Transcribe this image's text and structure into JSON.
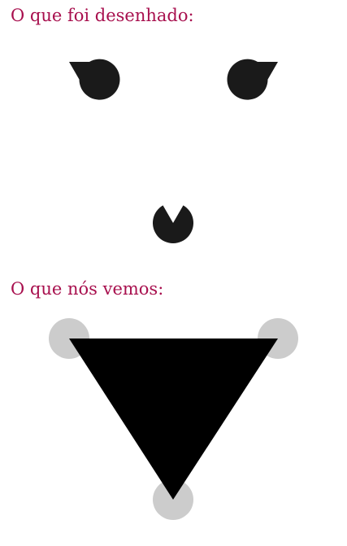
{
  "captions": {
    "drawn": "O que foi desenhado:",
    "seen": "O que nós vemos:"
  },
  "colors": {
    "caption": "#a8104e",
    "inducer": "#1a1a1a",
    "triangle": "#000000",
    "circle_ghost": "#cccccc",
    "background": "#ffffff"
  },
  "figures": {
    "drawn": {
      "shape": "pac-man inducers",
      "count": 3,
      "illusory_shape": "inverted triangle"
    },
    "seen": {
      "shape": "inverted triangle over grey circles",
      "circle_count": 3
    }
  }
}
